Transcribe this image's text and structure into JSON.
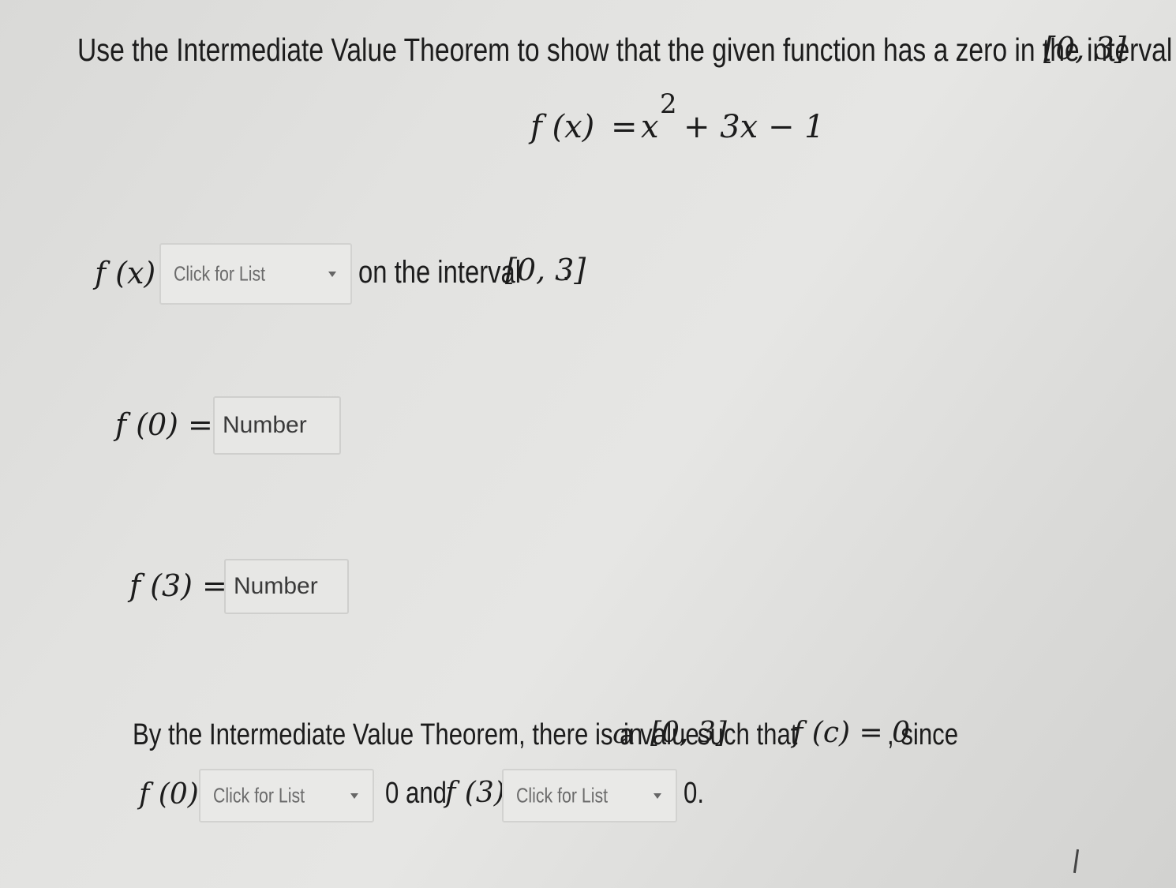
{
  "question": {
    "intro": "Use the Intermediate Value Theorem to show that the given function has a zero in the interval ",
    "interval": "[0, 3]",
    "end_punct": "."
  },
  "function_def": {
    "lhs": "f (x)",
    "equals": "=",
    "x": "x",
    "exp": "2",
    "rest": "+ 3x − 1"
  },
  "continuity_row": {
    "label": "f (x)",
    "dropdown_placeholder": "Click for List",
    "suffix": "on the interval ",
    "interval": "[0, 3]",
    "end_punct": "."
  },
  "f0_row": {
    "label": "f (0) =",
    "placeholder": "Number"
  },
  "f3_row": {
    "label": "f (3) =",
    "placeholder": "Number"
  },
  "conclusion": {
    "line1_text": "By the Intermediate Value Theorem, there is a value ",
    "var_c": "c",
    "line1_in": " in ",
    "interval": "[0, 3]",
    "line1_such": " such that ",
    "fc_eq": "f (c) = 0",
    "line1_since": ", since",
    "f0_label": "f (0)",
    "dropdown1_placeholder": "Click for List",
    "middle_text": "0 and ",
    "f3_label": "f (3)",
    "dropdown2_placeholder": "Click for List",
    "end_text": "0."
  }
}
